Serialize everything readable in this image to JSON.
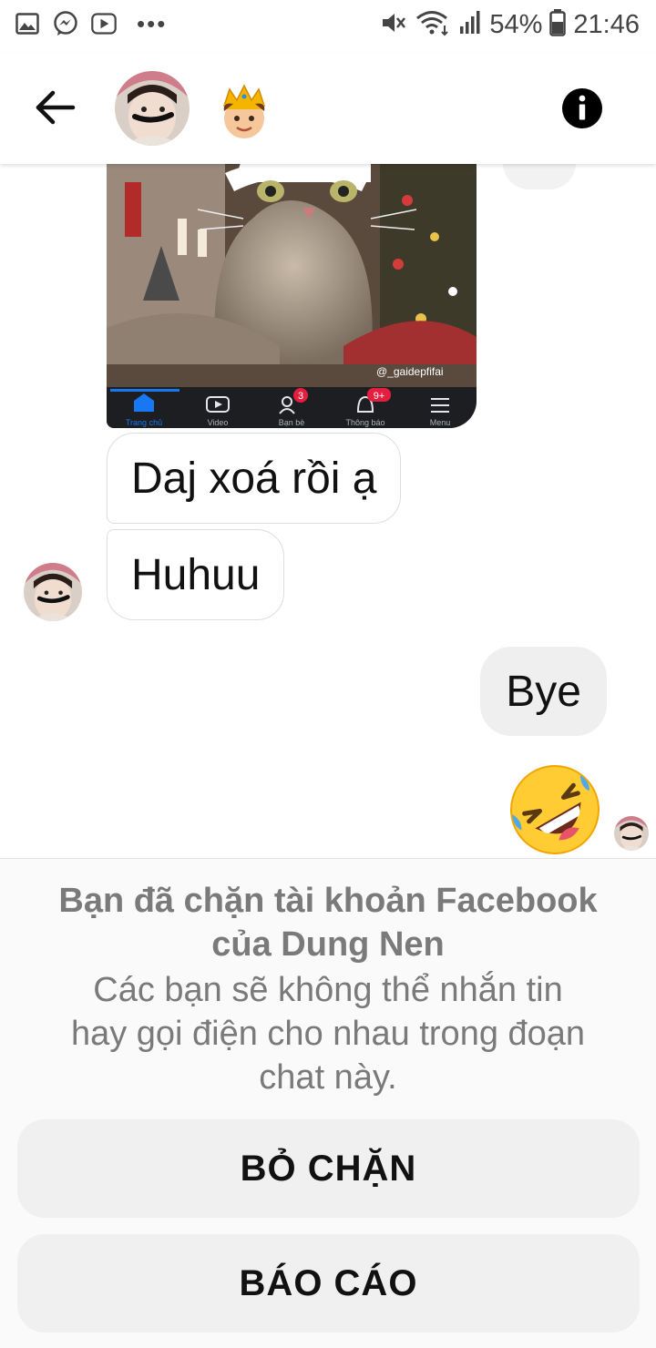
{
  "status_bar": {
    "battery": "54%",
    "time": "21:46",
    "icons": [
      "gallery-icon",
      "messenger-icon",
      "youtube-icon",
      "more-dots-icon",
      "mute-icon",
      "wifi-icon",
      "signal-icon",
      "battery-icon"
    ]
  },
  "header": {
    "icons": [
      "back-arrow-icon",
      "avatar",
      "crown-emoji",
      "info-icon"
    ]
  },
  "messages": {
    "photo_watermark": "@_gaidepfifai",
    "photo_nav": [
      "Trang chủ",
      "Video",
      "Bạn bè",
      "Thông báo",
      "Menu"
    ],
    "photo_badges": [
      "3",
      "9+"
    ],
    "incoming_1": "Daj xoá rồi ạ",
    "incoming_2": "Huhuu",
    "outgoing_1": "Bye",
    "outgoing_emoji": "rolling-on-floor-laughing"
  },
  "blocked": {
    "title_line1": "Bạn đã chặn tài khoản Facebook",
    "title_line2": "của Dung Nen",
    "description_line1": "Các bạn sẽ không thể nhắn tin",
    "description_line2": "hay gọi điện cho nhau trong đoạn",
    "description_line3": "chat này.",
    "unblock_label": "BỎ CHẶN",
    "report_label": "BÁO CÁO"
  },
  "colors": {
    "accent_blue": "#1877f2",
    "muted_text": "#7a7a7a",
    "badge_red": "#e41e3f"
  }
}
